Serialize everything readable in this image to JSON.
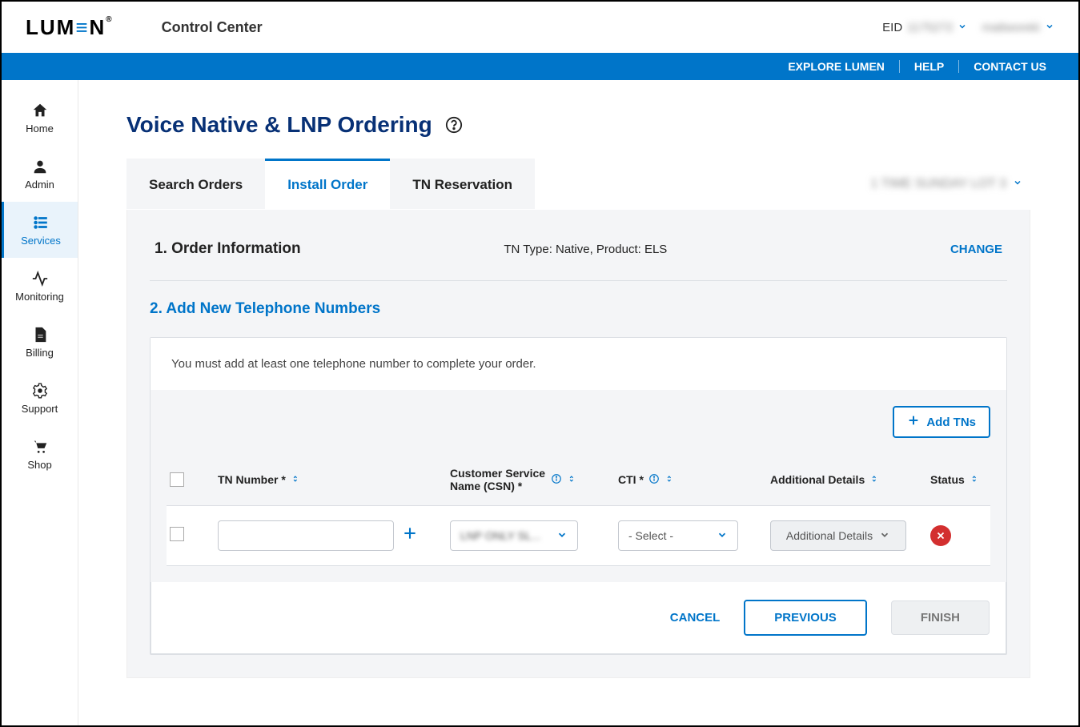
{
  "header": {
    "logo_text": "LUMEN",
    "app_name": "Control Center",
    "eid_label": "EID",
    "eid_value": "1175272",
    "username": "mattworeki"
  },
  "bluebar": {
    "explore": "EXPLORE LUMEN",
    "help": "HELP",
    "contact": "CONTACT US"
  },
  "sidebar": {
    "items": [
      {
        "label": "Home"
      },
      {
        "label": "Admin"
      },
      {
        "label": "Services"
      },
      {
        "label": "Monitoring"
      },
      {
        "label": "Billing"
      },
      {
        "label": "Support"
      },
      {
        "label": "Shop"
      }
    ]
  },
  "page": {
    "title": "Voice Native & LNP Ordering"
  },
  "tabs": {
    "search": "Search Orders",
    "install": "Install Order",
    "reservation": "TN Reservation",
    "account_selected": "1 TIME SUNDAY LOT 3"
  },
  "step1": {
    "title": "1. Order Information",
    "subtitle": "TN Type: Native, Product: ELS",
    "change": "CHANGE"
  },
  "step2": {
    "title": "2. Add New Telephone Numbers",
    "message": "You must add at least one telephone number to complete your order.",
    "add_tns": "Add TNs"
  },
  "table": {
    "headers": {
      "tn_number": "TN Number *",
      "csn": "Customer Service Name (CSN) *",
      "cti": "CTI *",
      "addl": "Additional Details",
      "status": "Status"
    },
    "row": {
      "tn_value": "",
      "csn_value": "LNP ONLY SL...",
      "cti_value": "- Select -",
      "addl_label": "Additional Details"
    }
  },
  "actions": {
    "cancel": "CANCEL",
    "previous": "PREVIOUS",
    "finish": "FINISH"
  }
}
